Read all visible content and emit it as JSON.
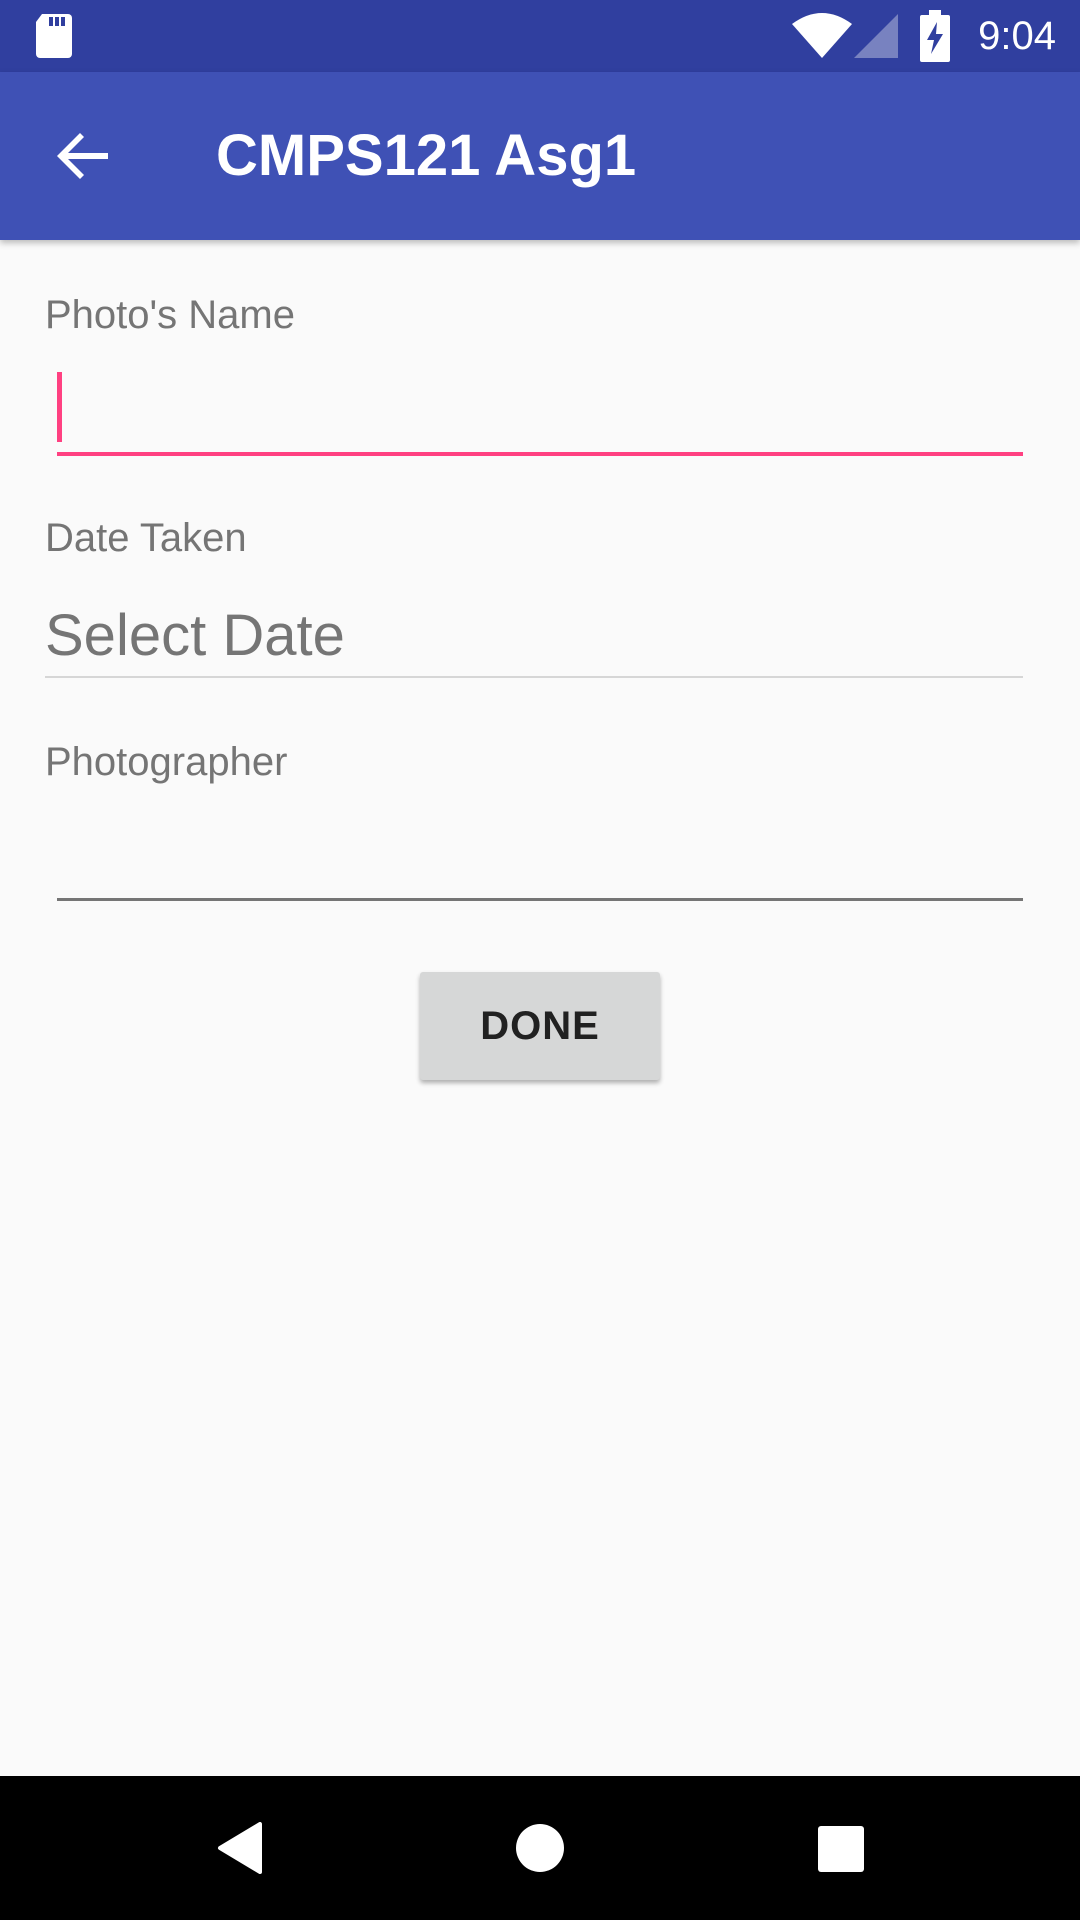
{
  "status_bar": {
    "time": "9:04",
    "icons": [
      "sd-card-icon",
      "wifi-icon",
      "signal-icon",
      "battery-charging-icon"
    ]
  },
  "app_bar": {
    "title": "CMPS121 Asg1",
    "back_icon": "arrow-left-icon"
  },
  "form": {
    "photo_name": {
      "label": "Photo's Name",
      "value": ""
    },
    "date_taken": {
      "label": "Date Taken",
      "value": "Select Date"
    },
    "photographer": {
      "label": "Photographer",
      "value": ""
    },
    "done_label": "DONE"
  },
  "nav_bar": {
    "icons": [
      "nav-back-icon",
      "nav-home-icon",
      "nav-recents-icon"
    ]
  },
  "colors": {
    "status_bar": "#303f9f",
    "app_bar": "#3f51b5",
    "accent": "#ff4081",
    "background": "#fafafa"
  }
}
